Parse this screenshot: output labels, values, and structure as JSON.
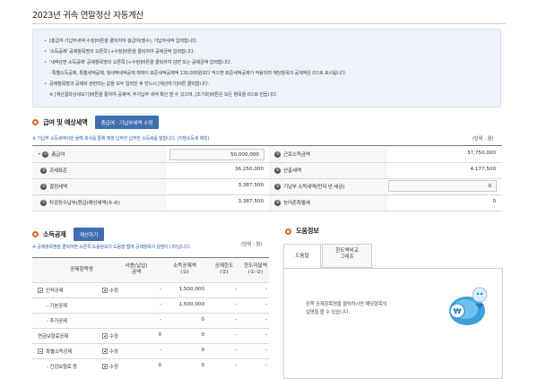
{
  "page": {
    "title": "2023년 귀속 연말정산 자동계산"
  },
  "guide": {
    "lines": [
      "[총급여·기납부세액 수정]버튼을 클릭하여 총급여(필수), 기납부세액 입력합니다.",
      "'소득공제' 공제항목명의 오른쪽 [+수정]버튼을 클릭하여 공제금액 입력합니다.",
      "'세액감면·소득공제' 공제항목명의 오른쪽 [+수정]버튼을 클릭하여 감면 또는 공제금액 입력합니다.",
      "· 특별소득공제, 특별세액공제, 월세액세액공제 체택이 표준세액공제액 130,000원보다 적으면 표준세액공제가 적용되며 해당항목의 공제액은 0으로 표시됩니다.",
      "공제항목명과 공제와 관련되는 값을 모두 입력한 후 반드시 [계산하기]버튼 클릭합니다.",
      "※ [계산결과상세보기]버튼을 통하여 공제액, 추가납부 세액 확인 할 수 있으며, [초기화]버튼은 모든 항목을 0으로 만듭니다."
    ]
  },
  "salary": {
    "title": "급여 및 예상세액",
    "edit_button": "총급여 · 기납부세액 수정",
    "note": "※ 기납부 소득세액이란 올해 회사를 통해 매월 납부한 납부한 소득세를 말합니다. (지방소득세 제외)",
    "unit": "(단위 : 원)",
    "rows": [
      {
        "num": "①",
        "label": "총급여",
        "value": "50,000,000",
        "num2": "②",
        "label2": "근로소득금액",
        "value2": "37,750,000"
      },
      {
        "num": "③",
        "label": "과세표준",
        "value": "36,250,000",
        "num2": "④",
        "label2": "산출세액",
        "value2": "4,177,500"
      },
      {
        "num": "⑤",
        "label": "결정세액",
        "value": "3,387,500",
        "num2": "⑥",
        "label2": "기납부 소득세액(먼저 낸 세금)",
        "value2": "0"
      },
      {
        "num": "⑦",
        "label": "차감징수납부(환급)예상세액(⑤-⑥)",
        "value": "3,387,500",
        "num2": "⑧",
        "label2": "농어촌특별세",
        "value2": "0"
      }
    ]
  },
  "deduction": {
    "title": "소득공제",
    "calc_button": "계산하기",
    "note": "※ 공제항목명을 클릭하면 오른쪽 도움정보의 도움말 탭에 공제항목의 설명이 나타납니다.",
    "unit": "(단위 : 원)",
    "headers": [
      "공제항목명",
      "사용(납입)\n금액",
      "소득공제액\n(①)",
      "공제한도\n(②)",
      "한도미달액\n(①-②)"
    ],
    "rows": [
      {
        "label": "인적공제",
        "edit": "수정",
        "amount": "-",
        "deduct": "1,500,000",
        "limit": "-",
        "under": "-"
      },
      {
        "label": "- 기본공제",
        "edit": "",
        "amount": "-",
        "deduct": "1,500,000",
        "limit": "-",
        "under": "-"
      },
      {
        "label": "- 추가공제",
        "edit": "",
        "amount": "-",
        "deduct": "0",
        "limit": "-",
        "under": "-"
      },
      {
        "label": "연금보험료공제",
        "edit": "수정",
        "amount": "0",
        "deduct": "0",
        "limit": "-",
        "under": "-"
      },
      {
        "label": "특별소득공제",
        "edit": "수정",
        "amount": "-",
        "deduct": "0",
        "limit": "-",
        "under": "-"
      },
      {
        "label": "- 건강보험료 등",
        "edit": "수정",
        "amount": "0",
        "deduct": "0",
        "limit": "-",
        "under": "-"
      }
    ]
  },
  "help": {
    "title": "도움정보",
    "tabs": [
      "도움말",
      "한도액비교\n그래프"
    ],
    "text_lines": [
      "왼쪽 공제항목명을 클릭하시면 해당항목의",
      "설명을 볼 수 있습니다."
    ]
  },
  "colors": {
    "accent": "#3f6fae",
    "section_dot": "#e8602c",
    "note": "#2e62b0"
  }
}
